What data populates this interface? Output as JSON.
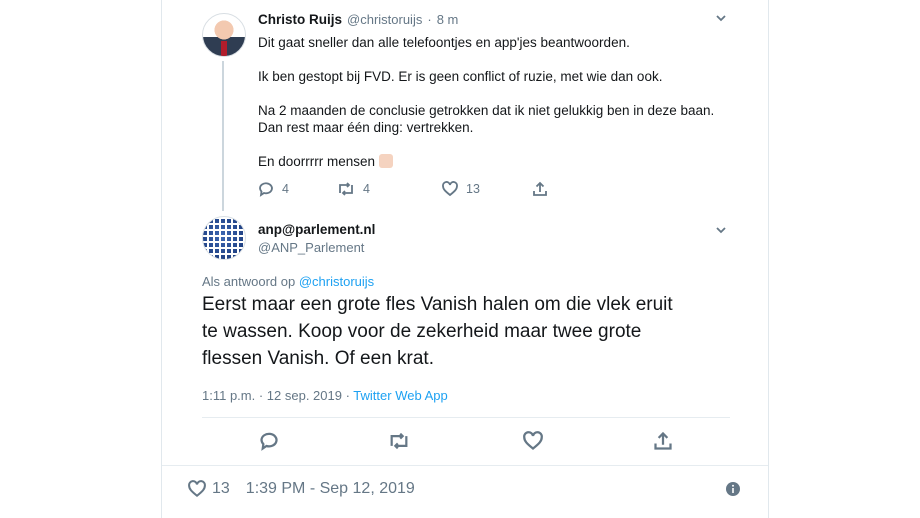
{
  "tweet1": {
    "name": "Christo Ruijs",
    "handle": "@christoruijs",
    "dot": "·",
    "time": "8 m",
    "lines": [
      "Dit gaat sneller dan alle telefoontjes en app'jes beantwoorden.",
      "Ik ben gestopt bij FVD. Er is geen conflict of ruzie, met wie dan ook.",
      "Na 2 maanden de conclusie getrokken dat ik niet gelukkig ben in deze baan.",
      "Dan rest maar één ding: vertrekken.",
      "En doorrrrr mensen"
    ],
    "replies": "4",
    "retweets": "4",
    "likes": "13"
  },
  "tweet2": {
    "name": "anp@parlement.nl",
    "handle": "@ANP_Parlement",
    "reply_prefix": "Als antwoord op",
    "reply_to": "@christoruijs",
    "text_lines": [
      "Eerst maar een grote fles Vanish halen om die vlek eruit",
      "te wassen. Koop voor de zekerheid maar twee grote",
      "flessen Vanish. Of een krat."
    ],
    "time": "1:11 p.m. · 12 sep. 2019 ·",
    "source": "Twitter Web App"
  },
  "footer": {
    "likes": "13",
    "timestamp": "1:39 PM - Sep 12, 2019"
  }
}
